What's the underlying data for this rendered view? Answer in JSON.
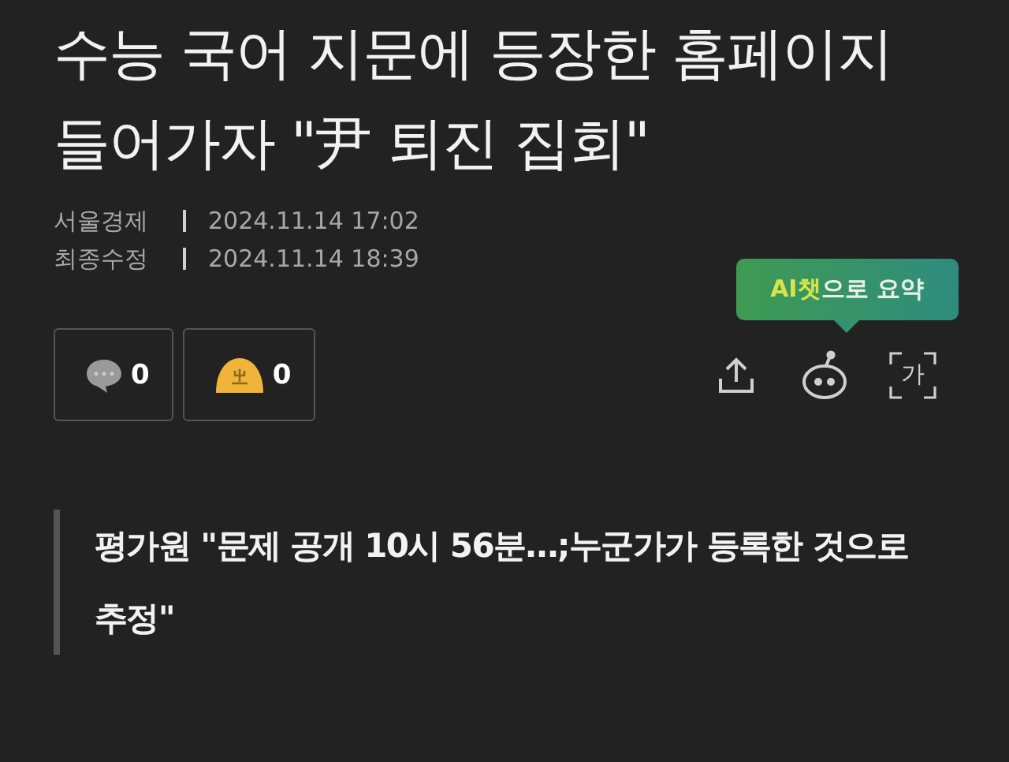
{
  "headline": "수능 국어 지문에 등장한 홈페이지 들어가자 \"尹 퇴진 집회\"",
  "meta": [
    {
      "label": "서울경제",
      "value": "2024.11.14 17:02"
    },
    {
      "label": "최종수정",
      "value": "2024.11.14 18:39"
    }
  ],
  "reactions": [
    {
      "kind": "comment",
      "count": "0"
    },
    {
      "kind": "like",
      "count": "0"
    }
  ],
  "tooltip": {
    "highlight": "AI챗",
    "text": "으로 요약"
  },
  "actions": [
    {
      "kind": "share"
    },
    {
      "kind": "bot"
    },
    {
      "kind": "font",
      "label": "가"
    }
  ],
  "subheadline": "평가원 \"문제 공개 10시 56분…;누군가가 등록한 것으로 추정\""
}
